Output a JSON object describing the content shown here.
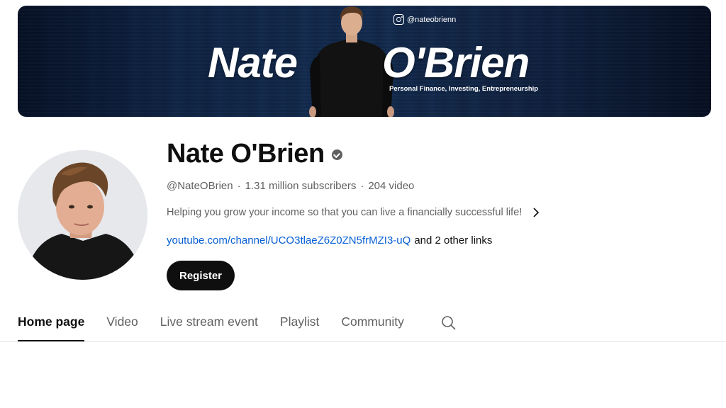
{
  "banner": {
    "name_first": "Nate",
    "name_last": "O'Brien",
    "instagram_handle": "@nateobrienn",
    "tagline": "Personal Finance, Investing, Entrepreneurship"
  },
  "channel": {
    "name": "Nate O'Brien",
    "handle": "@NateOBrien",
    "subscribers": "1.31 million subscribers",
    "videos": "204 video",
    "separator": "·",
    "description": "Helping you grow your income so that you can live a financially successful life!",
    "link_url": "youtube.com/channel/UCO3tlaeZ6Z0ZN5frMZI3-uQ",
    "other_links": "and 2 other links",
    "register_label": "Register"
  },
  "tabs": [
    {
      "label": "Home page",
      "active": true
    },
    {
      "label": "Video",
      "active": false
    },
    {
      "label": "Live stream event",
      "active": false
    },
    {
      "label": "Playlist",
      "active": false
    },
    {
      "label": "Community",
      "active": false
    }
  ],
  "icons": {
    "verified": "verified-check-icon",
    "chevron": "chevron-right-icon",
    "search": "search-icon",
    "instagram": "instagram-icon"
  },
  "colors": {
    "link": "#065fd4",
    "text_primary": "#0f0f0f",
    "text_secondary": "#606060",
    "button_bg": "#0f0f0f"
  }
}
